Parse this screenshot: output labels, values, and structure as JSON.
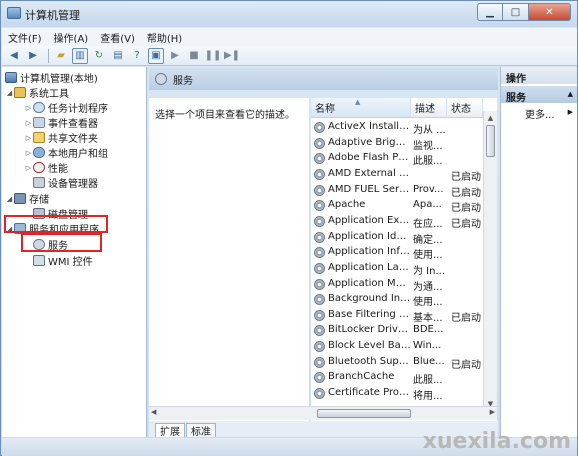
{
  "window": {
    "title": "计算机管理"
  },
  "menu": [
    "文件(F)",
    "操作(A)",
    "查看(V)",
    "帮助(H)"
  ],
  "toolbar": [
    {
      "icon": "back-arrow-icon"
    },
    {
      "icon": "forward-arrow-icon"
    },
    {
      "icon": "folder-up-icon"
    },
    {
      "icon": "show-tree-icon"
    },
    {
      "icon": "refresh-icon"
    },
    {
      "icon": "export-list-icon"
    },
    {
      "icon": "help-icon"
    },
    {
      "icon": "properties-icon"
    },
    {
      "icon": "play-icon"
    },
    {
      "icon": "stop-icon"
    },
    {
      "icon": "pause-icon"
    },
    {
      "icon": "restart-icon"
    }
  ],
  "tree": {
    "root": "计算机管理(本地)",
    "system_tools": "系统工具",
    "task_scheduler": "任务计划程序",
    "event_viewer": "事件查看器",
    "shared_folders": "共享文件夹",
    "local_users": "本地用户和组",
    "performance": "性能",
    "device_manager": "设备管理器",
    "storage": "存储",
    "disk_management": "磁盘管理",
    "services_apps": "服务和应用程序",
    "services": "服务",
    "wmi": "WMI 控件"
  },
  "center": {
    "header": "服务",
    "description": "选择一个项目来查看它的描述。",
    "columns": {
      "name": "名称",
      "desc": "描述",
      "state": "状态"
    },
    "services": [
      {
        "name": "ActiveX Installer ...",
        "desc": "为从 ...",
        "state": ""
      },
      {
        "name": "Adaptive Brightn...",
        "desc": "监视...",
        "state": ""
      },
      {
        "name": "Adobe Flash Pla...",
        "desc": "此服...",
        "state": ""
      },
      {
        "name": "AMD External Ev...",
        "desc": "",
        "state": "已启动"
      },
      {
        "name": "AMD FUEL Service",
        "desc": "Prov...",
        "state": "已启动"
      },
      {
        "name": "Apache",
        "desc": "Apa...",
        "state": "已启动"
      },
      {
        "name": "Application Expe...",
        "desc": "在应...",
        "state": "已启动"
      },
      {
        "name": "Application Iden...",
        "desc": "确定...",
        "state": ""
      },
      {
        "name": "Application Infor...",
        "desc": "使用...",
        "state": ""
      },
      {
        "name": "Application Laye...",
        "desc": "为 In...",
        "state": ""
      },
      {
        "name": "Application Man...",
        "desc": "为通...",
        "state": ""
      },
      {
        "name": "Background Inte...",
        "desc": "使用...",
        "state": ""
      },
      {
        "name": "Base Filtering En...",
        "desc": "基本...",
        "state": "已启动"
      },
      {
        "name": "BitLocker Drive ...",
        "desc": "BDE...",
        "state": ""
      },
      {
        "name": "Block Level Back...",
        "desc": "Win...",
        "state": ""
      },
      {
        "name": "Bluetooth Supp...",
        "desc": "Blue...",
        "state": "已启动"
      },
      {
        "name": "BranchCache",
        "desc": "此服...",
        "state": ""
      },
      {
        "name": "Certificate Propa...",
        "desc": "将用...",
        "state": ""
      }
    ]
  },
  "bottom_tabs": [
    "扩展",
    "标准"
  ],
  "actions": {
    "title": "操作",
    "section": "服务",
    "more": "更多..."
  },
  "watermark": "xuexila.com"
}
